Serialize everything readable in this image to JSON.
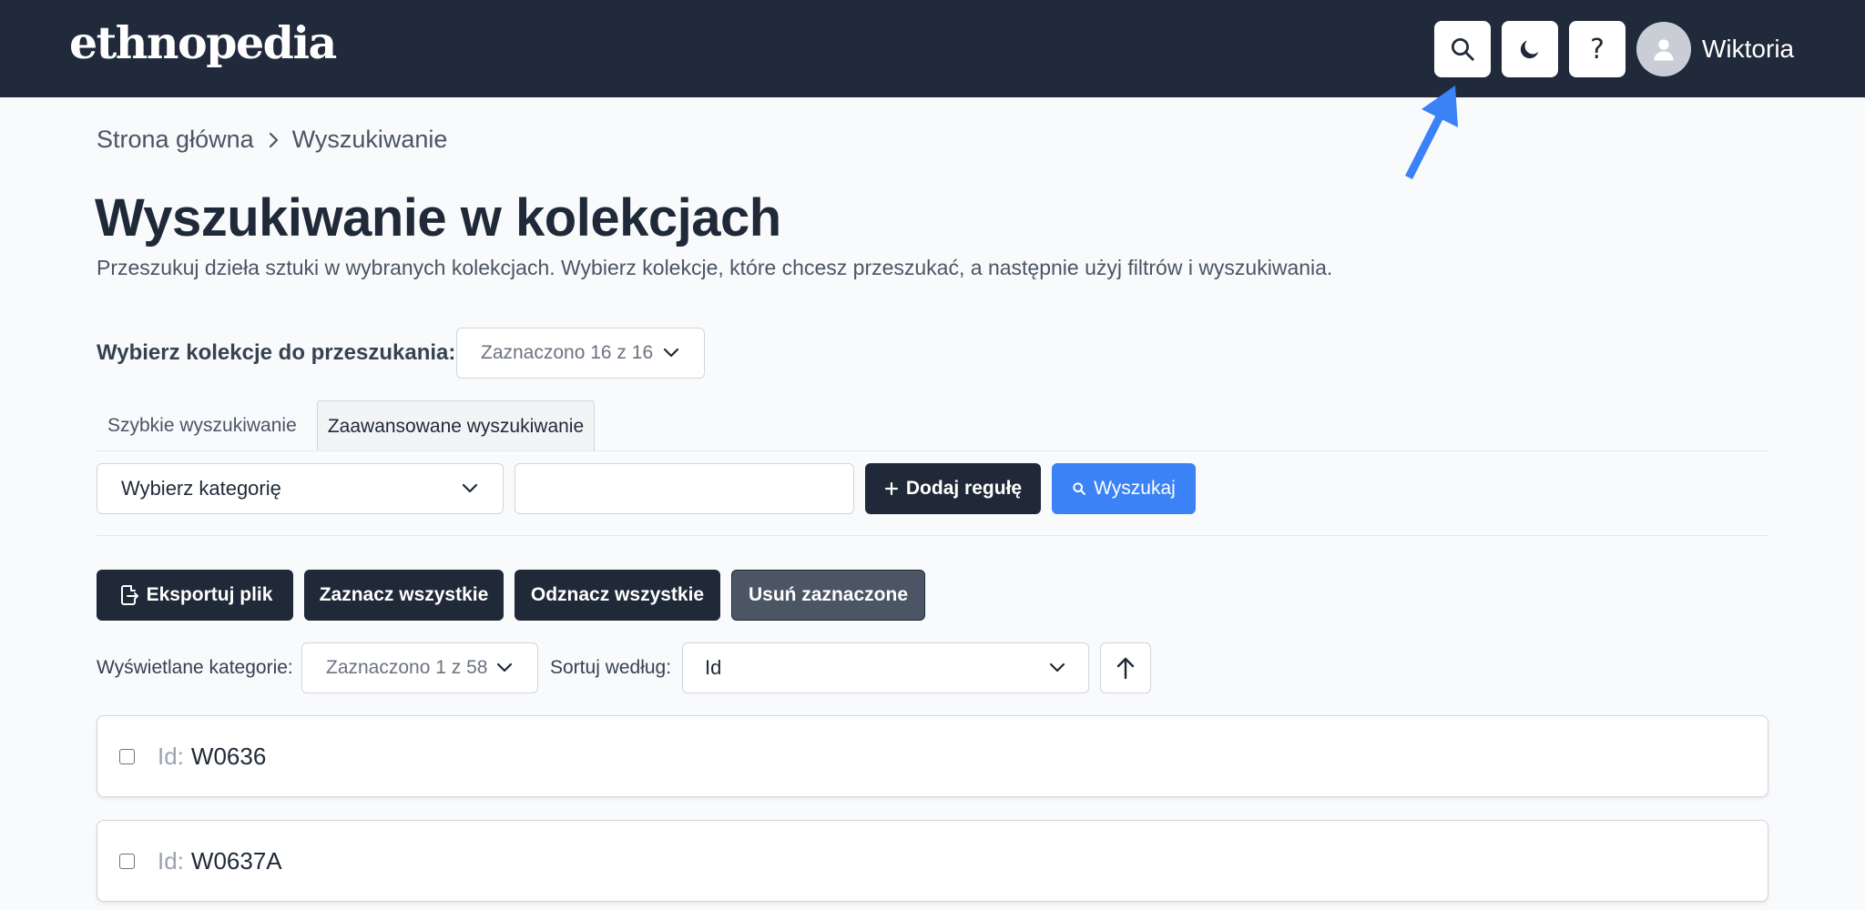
{
  "header": {
    "logo": "ethnopedia",
    "user_name": "Wiktoria",
    "help_label": "?",
    "icons": [
      "search-icon",
      "moon-icon",
      "help-icon",
      "user-icon"
    ]
  },
  "breadcrumb": {
    "home": "Strona główna",
    "current": "Wyszukiwanie"
  },
  "page": {
    "title": "Wyszukiwanie w kolekcjach",
    "description": "Przeszukuj dzieła sztuki w wybranych kolekcjach. Wybierz kolekcje, które chcesz przeszukać, a następnie użyj filtrów i wyszukiwania."
  },
  "collections": {
    "label": "Wybierz kolekcje do przeszukania:",
    "selected": "Zaznaczono 16 z 16"
  },
  "tabs": {
    "quick": "Szybkie wyszukiwanie",
    "advanced": "Zaawansowane wyszukiwanie",
    "active": "advanced"
  },
  "advanced": {
    "category_placeholder": "Wybierz kategorię",
    "value_input": "",
    "add_rule": "Dodaj regułę",
    "search": "Wyszukaj"
  },
  "actions": {
    "export": "Eksportuj plik",
    "select_all": "Zaznacz wszystkie",
    "deselect_all": "Odznacz wszystkie",
    "delete_selected": "Usuń zaznaczone"
  },
  "display": {
    "categories_label": "Wyświetlane kategorie:",
    "categories_selected": "Zaznaczono 1 z 58",
    "sort_label": "Sortuj według:",
    "sort_value": "Id"
  },
  "results": [
    {
      "label": "Id:",
      "value": "W0636"
    },
    {
      "label": "Id:",
      "value": "W0637A"
    }
  ],
  "colors": {
    "header_bg": "#212a3b",
    "accent_blue": "#3b82f6",
    "dark_button": "#1f2937",
    "gray_button": "#4b5563",
    "annotation_arrow": "#3b82f6"
  }
}
